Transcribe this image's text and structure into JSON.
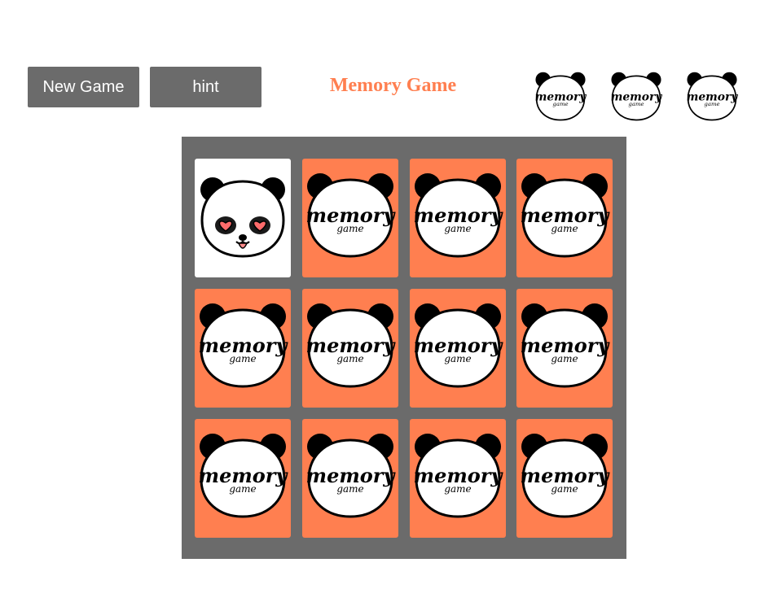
{
  "toolbar": {
    "new_game_label": "New Game",
    "hint_label": "hint"
  },
  "title": "Memory Game",
  "lives": {
    "count": 3,
    "icon": "panda-life-icon",
    "logo_text": "memory",
    "logo_subtext": "game"
  },
  "board": {
    "rows": 3,
    "cols": 4,
    "cards": [
      {
        "state": "face-up",
        "face": "panda-heart-eyes"
      },
      {
        "state": "face-down"
      },
      {
        "state": "face-down"
      },
      {
        "state": "face-down"
      },
      {
        "state": "face-down"
      },
      {
        "state": "face-down"
      },
      {
        "state": "face-down"
      },
      {
        "state": "face-down"
      },
      {
        "state": "face-down"
      },
      {
        "state": "face-down"
      },
      {
        "state": "face-down"
      },
      {
        "state": "face-down"
      }
    ],
    "card_back": {
      "logo_text": "memory",
      "logo_subtext": "game"
    }
  },
  "colors": {
    "accent": "#ff7f50",
    "board": "#6b6b6b",
    "button": "#6b6b6b",
    "card_face": "#ffffff"
  }
}
